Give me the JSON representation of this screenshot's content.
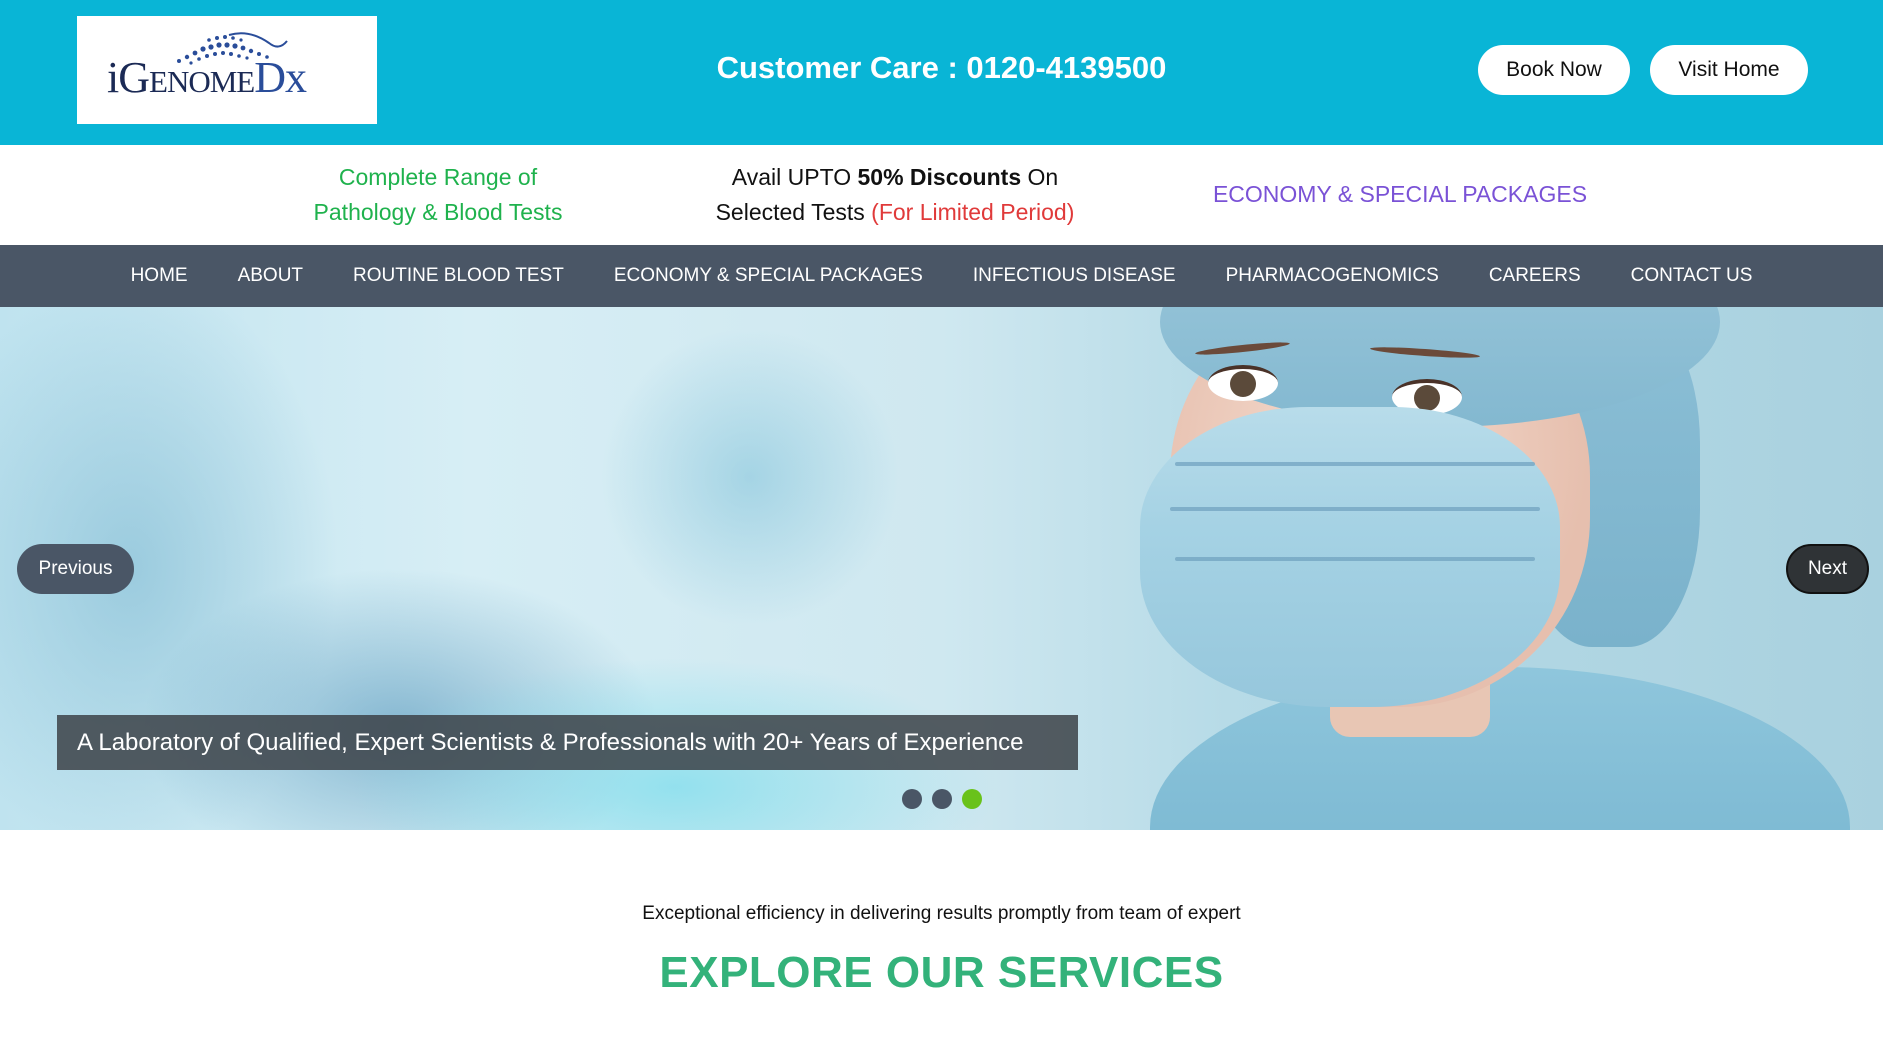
{
  "header": {
    "logo": {
      "alt": "iGenomeDx",
      "i": "i",
      "genome": "Genome",
      "dx": "Dx"
    },
    "customer_care": "Customer Care : 0120-4139500",
    "book_now": "Book Now",
    "visit_home": "Visit Home",
    "colors": {
      "bar": "#09b5d6"
    }
  },
  "strip": {
    "col1_line1": "Complete Range of",
    "col1_line2": "Pathology & Blood Tests",
    "col2_pre": "Avail UPTO ",
    "col2_bold": "50% Discounts",
    "col2_post": " On",
    "col2_line2_pre": "Selected Tests ",
    "col2_line2_red": "(For Limited Period)",
    "col3": "ECONOMY & SPECIAL PACKAGES"
  },
  "nav": {
    "items": [
      {
        "label": "HOME"
      },
      {
        "label": "ABOUT"
      },
      {
        "label": "ROUTINE BLOOD TEST"
      },
      {
        "label": "ECONOMY & SPECIAL PACKAGES"
      },
      {
        "label": "INFECTIOUS DISEASE"
      },
      {
        "label": "PHARMACOGENOMICS"
      },
      {
        "label": "CAREERS"
      },
      {
        "label": "CONTACT US"
      }
    ]
  },
  "hero": {
    "prev": "Previous",
    "next": "Next",
    "caption": "A Laboratory of Qualified, Expert Scientists & Professionals with 20+ Years of Experience",
    "slides_total": 3,
    "active_slide": 3
  },
  "services": {
    "tagline": "Exceptional efficiency in delivering results promptly from team of expert",
    "heading": "EXPLORE OUR SERVICES"
  }
}
